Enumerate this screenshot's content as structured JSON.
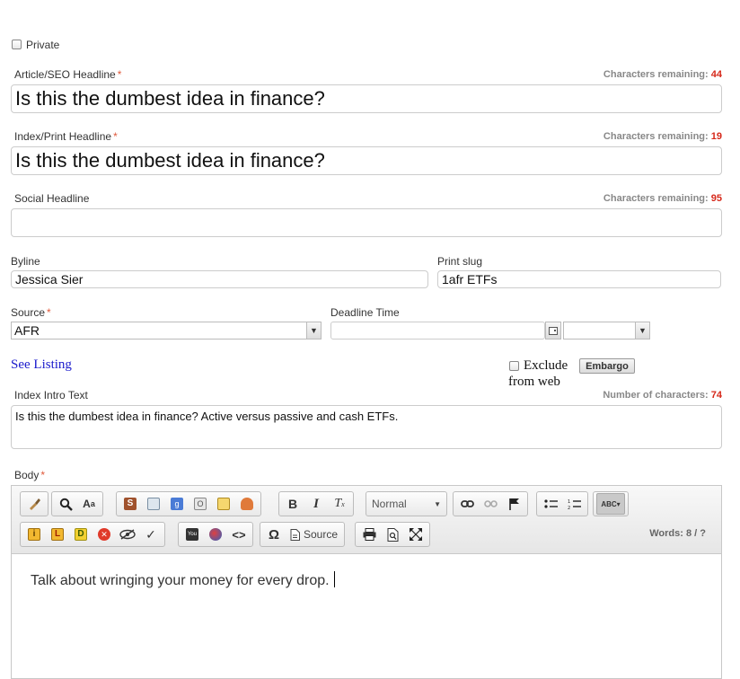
{
  "private": {
    "label": "Private",
    "checked": false
  },
  "required_mark": "*",
  "article_headline": {
    "label": "Article/SEO Headline",
    "remaining_label": "Characters remaining:",
    "remaining": "44",
    "value": "Is this the dumbest idea in finance?"
  },
  "index_headline": {
    "label": "Index/Print Headline",
    "remaining_label": "Characters remaining:",
    "remaining": "19",
    "value": "Is this the dumbest idea in finance?"
  },
  "social_headline": {
    "label": "Social Headline",
    "remaining_label": "Characters remaining:",
    "remaining": "95",
    "value": ""
  },
  "byline": {
    "label": "Byline",
    "value": "Jessica Sier"
  },
  "print_slug": {
    "label": "Print slug",
    "value": "1afr ETFs"
  },
  "source": {
    "label": "Source",
    "value": "AFR"
  },
  "deadline": {
    "label": "Deadline Time",
    "date_value": "",
    "time_value": ""
  },
  "see_listing": "See Listing",
  "exclude": {
    "line1": "Exclude",
    "line2": "from web",
    "checked": false
  },
  "embargo_label": "Embargo",
  "intro": {
    "label": "Index Intro Text",
    "count_label": "Number of characters:",
    "count": "74",
    "value": "Is this the dumbest idea in finance? Active versus passive and cash ETFs."
  },
  "body": {
    "label": "Body",
    "text": "Talk about wringing your money for every drop.",
    "words_label": "Words: 8 / ?"
  },
  "toolbar": {
    "format_select": "Normal",
    "source_label": "Source",
    "icons": {
      "g1": [
        "brush-icon"
      ],
      "g2": [
        "find-icon",
        "replace-icon"
      ],
      "g3": [
        "s-icon",
        "chart-icon",
        "google-icon",
        "opinion-icon",
        "calendar-icon",
        "person-icon"
      ],
      "g4": [
        "bold-icon",
        "italic-icon",
        "remove-format-icon"
      ],
      "g5": [
        "link-icon",
        "unlink-icon",
        "anchor-flag-icon"
      ],
      "g6": [
        "bulleted-list-icon",
        "numbered-list-icon"
      ],
      "g7": [
        "spellcheck-icon"
      ],
      "g8": [
        "info-i-icon",
        "info-l-icon",
        "info-d-icon",
        "delete-circle-icon",
        "hide-icon",
        "check-icon"
      ],
      "g9": [
        "youtube-icon",
        "globe-icon",
        "code-icon"
      ],
      "g10": [
        "omega-icon",
        "source-icon"
      ],
      "g11": [
        "print-icon",
        "preview-icon",
        "maximize-icon"
      ]
    }
  },
  "colors": {
    "required": "#e0593b",
    "remaining_number": "#d6281a",
    "link": "#1a1acc",
    "border": "#cccccc"
  }
}
